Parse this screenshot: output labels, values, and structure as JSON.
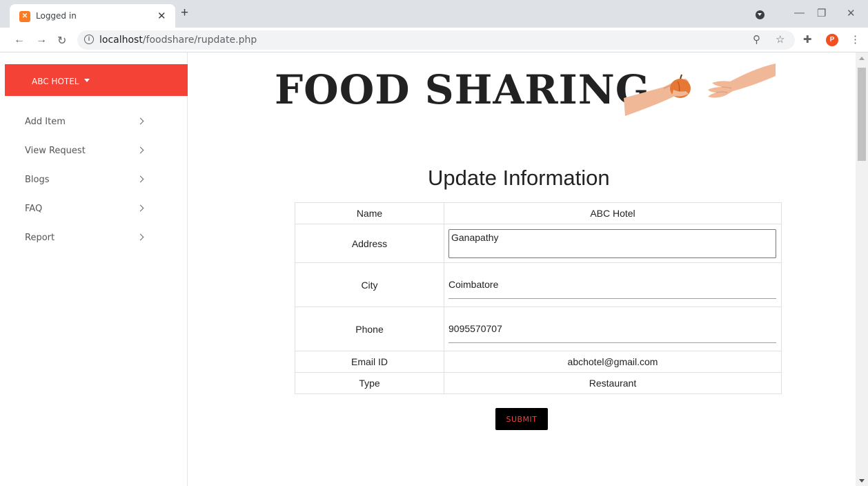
{
  "browser": {
    "tab_title": "Logged in",
    "tab_favicon": "xampp-icon",
    "new_tab": "+",
    "url_host": "localhost",
    "url_path": "/foodshare/rupdate.php",
    "profile_initial": "P"
  },
  "sidebar": {
    "header_label": "ABC HOTEL",
    "items": [
      {
        "label": "Add Item"
      },
      {
        "label": "View Request"
      },
      {
        "label": "Blogs"
      },
      {
        "label": "FAQ"
      },
      {
        "label": "Report"
      }
    ]
  },
  "brand": {
    "title": "FOOD SHARING",
    "image": "hands-sharing-apple"
  },
  "form": {
    "title": "Update Information",
    "rows": [
      {
        "label": "Name",
        "value": "ABC Hotel"
      },
      {
        "label": "Address",
        "value": "Ganapathy"
      },
      {
        "label": "City",
        "value": "Coimbatore"
      },
      {
        "label": "Phone",
        "value": "9095570707"
      },
      {
        "label": "Email ID",
        "value": "abchotel@gmail.com"
      },
      {
        "label": "Type",
        "value": "Restaurant"
      }
    ],
    "submit_label": "SUBMIT"
  },
  "colors": {
    "accent": "#f44336",
    "button_bg": "#000000"
  }
}
